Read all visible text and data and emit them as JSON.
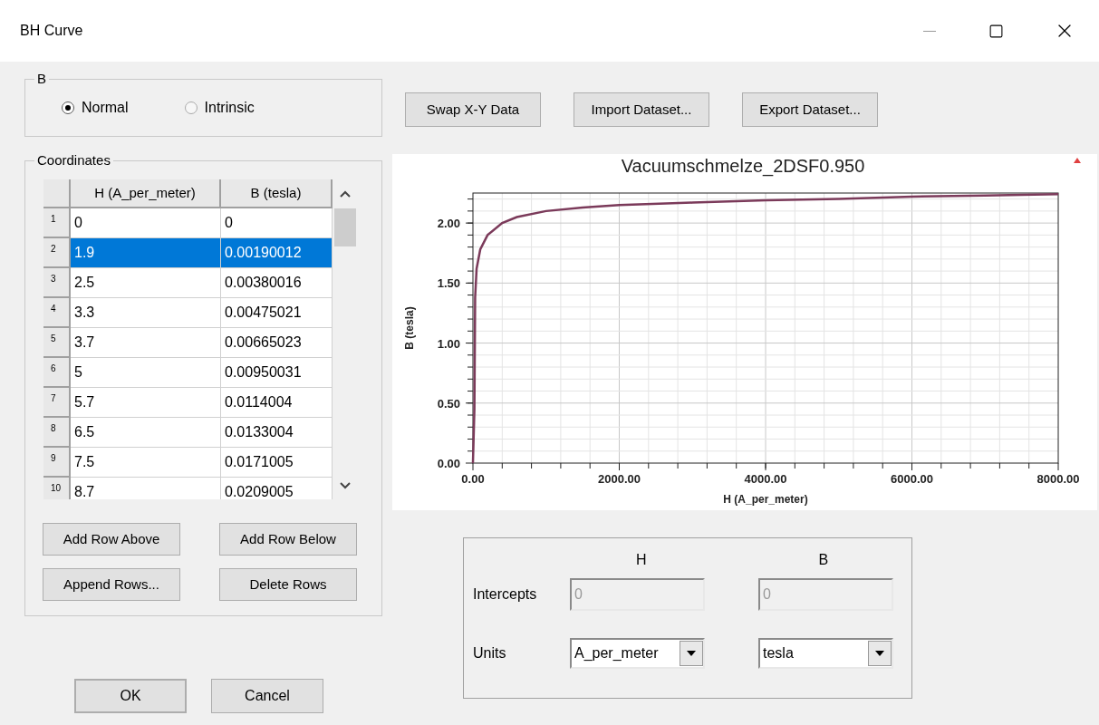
{
  "window": {
    "title": "BH Curve"
  },
  "b_group": {
    "title": "B",
    "options": [
      {
        "label": "Normal",
        "selected": true
      },
      {
        "label": "Intrinsic",
        "selected": false
      }
    ]
  },
  "coordinates": {
    "title": "Coordinates",
    "columns": [
      "H (A_per_meter)",
      "B (tesla)"
    ],
    "rows": [
      {
        "index": "1",
        "h": "0",
        "b": "0",
        "selected": false
      },
      {
        "index": "2",
        "h": "1.9",
        "b": "0.00190012",
        "selected": true
      },
      {
        "index": "3",
        "h": "2.5",
        "b": "0.00380016",
        "selected": false
      },
      {
        "index": "4",
        "h": "3.3",
        "b": "0.00475021",
        "selected": false
      },
      {
        "index": "5",
        "h": "3.7",
        "b": "0.00665023",
        "selected": false
      },
      {
        "index": "6",
        "h": "5",
        "b": "0.00950031",
        "selected": false
      },
      {
        "index": "7",
        "h": "5.7",
        "b": "0.0114004",
        "selected": false
      },
      {
        "index": "8",
        "h": "6.5",
        "b": "0.0133004",
        "selected": false
      },
      {
        "index": "9",
        "h": "7.5",
        "b": "0.0171005",
        "selected": false
      },
      {
        "index": "10",
        "h": "8.7",
        "b": "0.0209005",
        "selected": false
      }
    ],
    "buttons": [
      "Add Row Above",
      "Add Row Below",
      "Append Rows...",
      "Delete Rows"
    ]
  },
  "toolbar": [
    "Swap X-Y Data",
    "Import Dataset...",
    "Export Dataset..."
  ],
  "chart": {
    "chart_data": {
      "type": "line",
      "title": "Vacuumschmelze_2DSF0.950",
      "xlabel": "H (A_per_meter)",
      "ylabel": "B (tesla)",
      "x": [
        0,
        20,
        30,
        50,
        100,
        200,
        400,
        600,
        1000,
        1500,
        2000,
        3000,
        4000,
        5000,
        6000,
        7000,
        8000
      ],
      "grid": true,
      "series": [
        {
          "color": "#7b3a5a",
          "values": [
            0,
            0.45,
            1.38,
            1.62,
            1.78,
            1.9,
            2.0,
            2.05,
            2.1,
            2.13,
            2.15,
            2.17,
            2.19,
            2.2,
            2.22,
            2.23,
            2.24
          ]
        }
      ],
      "xlim": [
        0,
        8000
      ],
      "ylim": [
        0,
        2.25
      ],
      "xticks": [
        {
          "value": 0,
          "label": "0.00"
        },
        {
          "value": 2000,
          "label": "2000.00"
        },
        {
          "value": 4000,
          "label": "4000.00"
        },
        {
          "value": 6000,
          "label": "6000.00"
        },
        {
          "value": 8000,
          "label": "8000.00"
        }
      ],
      "yticks": [
        {
          "value": 0,
          "label": "0.00"
        },
        {
          "value": 0.5,
          "label": "0.50"
        },
        {
          "value": 1,
          "label": "1.00"
        },
        {
          "value": 1.5,
          "label": "1.50"
        },
        {
          "value": 2,
          "label": "2.00"
        }
      ]
    }
  },
  "settings": {
    "headers": [
      "H",
      "B"
    ],
    "intercepts": {
      "label": "Intercepts",
      "h": "0",
      "b": "0",
      "disabled": true
    },
    "units": {
      "label": "Units",
      "h": "A_per_meter",
      "b": "tesla"
    }
  },
  "dialog_buttons": [
    "OK",
    "Cancel"
  ]
}
